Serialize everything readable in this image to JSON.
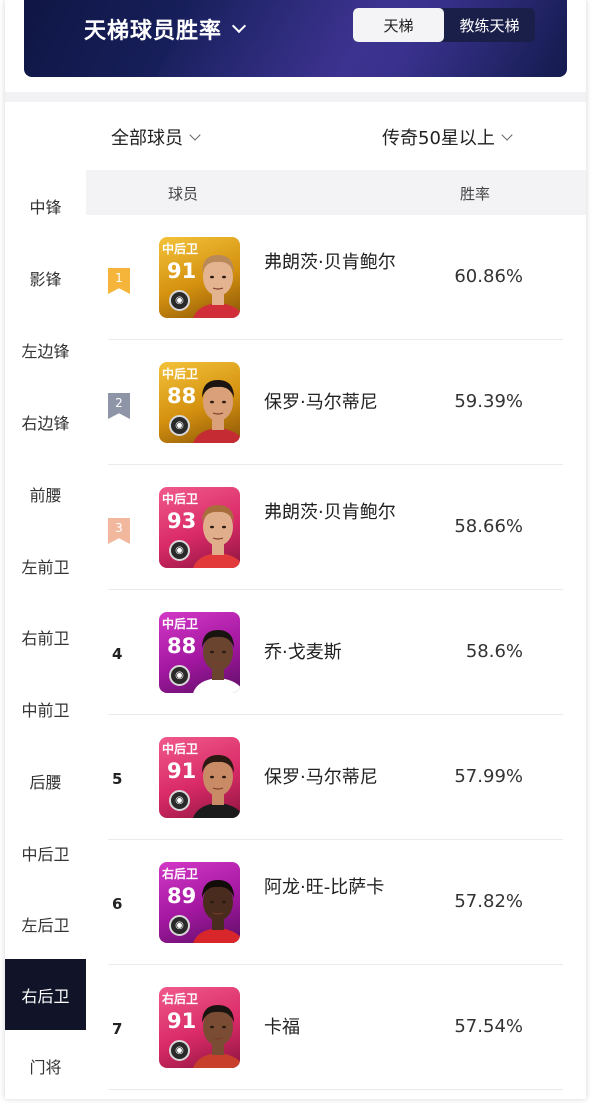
{
  "header": {
    "title": "天梯球员胜率",
    "tabs": [
      "天梯",
      "教练天梯"
    ],
    "active_tab": "天梯"
  },
  "filters": {
    "player_scope": "全部球员",
    "card_level": "传奇50星以上"
  },
  "sidebar": {
    "items": [
      "中锋",
      "影锋",
      "左边锋",
      "右边锋",
      "前腰",
      "左前卫",
      "右前卫",
      "中前卫",
      "后腰",
      "中后卫",
      "左后卫",
      "右后卫",
      "门将"
    ],
    "active": "右后卫"
  },
  "table": {
    "columns": [
      "球员",
      "胜率"
    ],
    "rows": [
      {
        "rank": "1",
        "position": "中后卫",
        "rating": "91",
        "name": "弗朗茨·贝肯鲍尔",
        "win_rate": "60.86%",
        "card_style": "gold",
        "badge_color": "#f5b53a"
      },
      {
        "rank": "2",
        "position": "中后卫",
        "rating": "88",
        "name": "保罗·马尔蒂尼",
        "win_rate": "59.39%",
        "card_style": "gold",
        "badge_color": "#8e95a6"
      },
      {
        "rank": "3",
        "position": "中后卫",
        "rating": "93",
        "name": "弗朗茨·贝肯鲍尔",
        "win_rate": "58.66%",
        "card_style": "pink",
        "badge_color": "#f2b89e"
      },
      {
        "rank": "4",
        "position": "中后卫",
        "rating": "88",
        "name": "乔·戈麦斯",
        "win_rate": "58.6%",
        "card_style": "purple",
        "badge_color": ""
      },
      {
        "rank": "5",
        "position": "中后卫",
        "rating": "91",
        "name": "保罗·马尔蒂尼",
        "win_rate": "57.99%",
        "card_style": "pink",
        "badge_color": ""
      },
      {
        "rank": "6",
        "position": "右后卫",
        "rating": "89",
        "name": "阿龙·旺-比萨卡",
        "win_rate": "57.82%",
        "card_style": "purple",
        "badge_color": ""
      },
      {
        "rank": "7",
        "position": "右后卫",
        "rating": "91",
        "name": "卡福",
        "win_rate": "57.54%",
        "card_style": "pink",
        "badge_color": ""
      }
    ]
  },
  "colors": {
    "banner_dark": "#0f1645",
    "sidebar_active": "#111428",
    "gold_card": "#d99a16",
    "pink_card": "#e0306e",
    "purple_card": "#b51aa6"
  }
}
